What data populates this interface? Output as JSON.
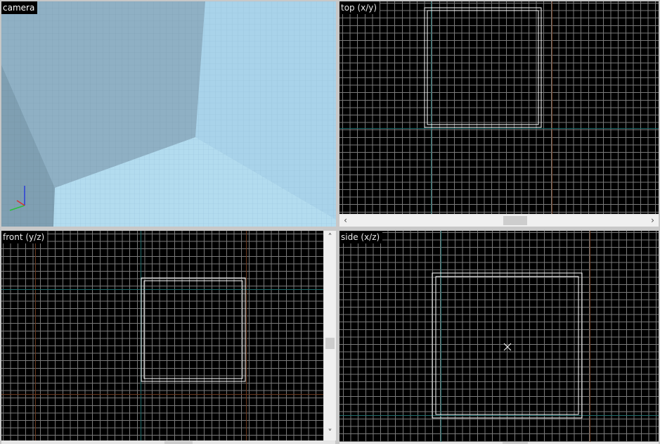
{
  "viewports": {
    "camera": {
      "label": "camera"
    },
    "top": {
      "label": "top (x/y)"
    },
    "front": {
      "label": "front (y/z)"
    },
    "side": {
      "label": "side (x/z)"
    }
  },
  "scrollbars": {
    "top_h": {
      "left_arrow": "‹",
      "right_arrow": "›"
    },
    "front_v": {
      "up_arrow": "˄",
      "down_arrow": "˅"
    }
  },
  "colors": {
    "grid_bg": "#000000",
    "grid_minor": "#7a7a7a",
    "grid_axis_teal": "#1e6e6e",
    "grid_axis_brown": "#6e3a1e",
    "brush_outline": "#ffffff",
    "camera_sky": "#9cc3d8"
  }
}
